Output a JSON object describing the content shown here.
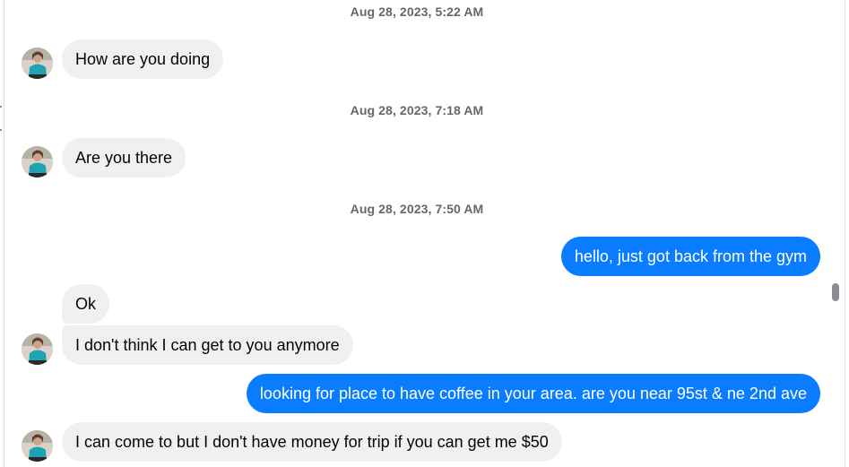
{
  "thread": {
    "timestamps": [
      "Aug 28, 2023, 5:22 AM",
      "Aug 28, 2023, 7:18 AM",
      "Aug 28, 2023, 7:50 AM"
    ],
    "messages": [
      {
        "from": "contact",
        "text": "How are you doing"
      },
      {
        "from": "contact",
        "text": "Are you there"
      },
      {
        "from": "me",
        "text": "hello, just got back from the gym"
      },
      {
        "from": "contact",
        "text": "Ok"
      },
      {
        "from": "contact",
        "text": "I don't think I can get to you anymore"
      },
      {
        "from": "me",
        "text": "looking for place to have coffee in your area. are you near 95st  & ne 2nd ave"
      },
      {
        "from": "contact",
        "text": "I can come to but I don't have money for trip if you can get me $50"
      }
    ]
  },
  "colors": {
    "outgoing_bubble": "#0a7cff",
    "incoming_bubble": "#f0f0f0",
    "timestamp_text": "#65676b"
  },
  "icons": {
    "avatar": "contact-avatar-photo"
  }
}
